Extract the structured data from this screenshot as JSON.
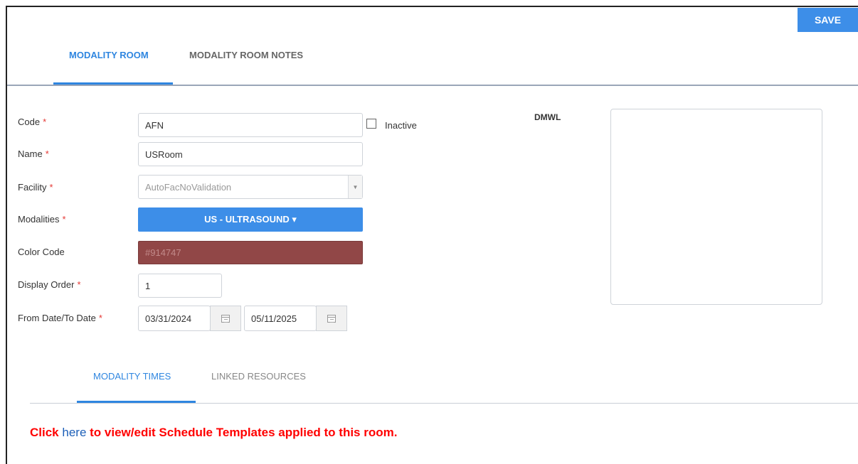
{
  "toolbar": {
    "save_label": "SAVE"
  },
  "tabs": [
    {
      "label": "MODALITY ROOM",
      "active": true
    },
    {
      "label": "MODALITY ROOM NOTES",
      "active": false
    }
  ],
  "form": {
    "code": {
      "label": "Code",
      "required_mark": "*",
      "value": "AFN"
    },
    "inactive": {
      "label": "Inactive",
      "checked": false
    },
    "name": {
      "label": "Name",
      "required_mark": "*",
      "value": "USRoom"
    },
    "facility": {
      "label": "Facility",
      "required_mark": "*",
      "value": "AutoFacNoValidation"
    },
    "modalities": {
      "label": "Modalities",
      "required_mark": "*",
      "value": "US - ULTRASOUND ▾"
    },
    "color_code": {
      "label": "Color Code",
      "value": "#914747"
    },
    "display_order": {
      "label": "Display Order",
      "required_mark": "*",
      "value": "1"
    },
    "dates": {
      "label": "From Date/To Date",
      "required_mark": "*",
      "from": "03/31/2024",
      "to": "05/11/2025"
    }
  },
  "dmwl": {
    "label": "DMWL"
  },
  "sub_tabs": [
    {
      "label": "MODALITY TIMES",
      "active": true
    },
    {
      "label": "LINKED RESOURCES",
      "active": false
    }
  ],
  "footer": {
    "prefix": "Click",
    "link": "here",
    "suffix": "to view/edit Schedule Templates applied to this room."
  },
  "colors": {
    "accent": "#2f86e0",
    "save_button": "#3d8ee8",
    "required": "#e53935",
    "room_color": "#914747",
    "footer_text": "#ff0000"
  },
  "icons": [
    "calendar-icon",
    "chevron-down-icon"
  ]
}
